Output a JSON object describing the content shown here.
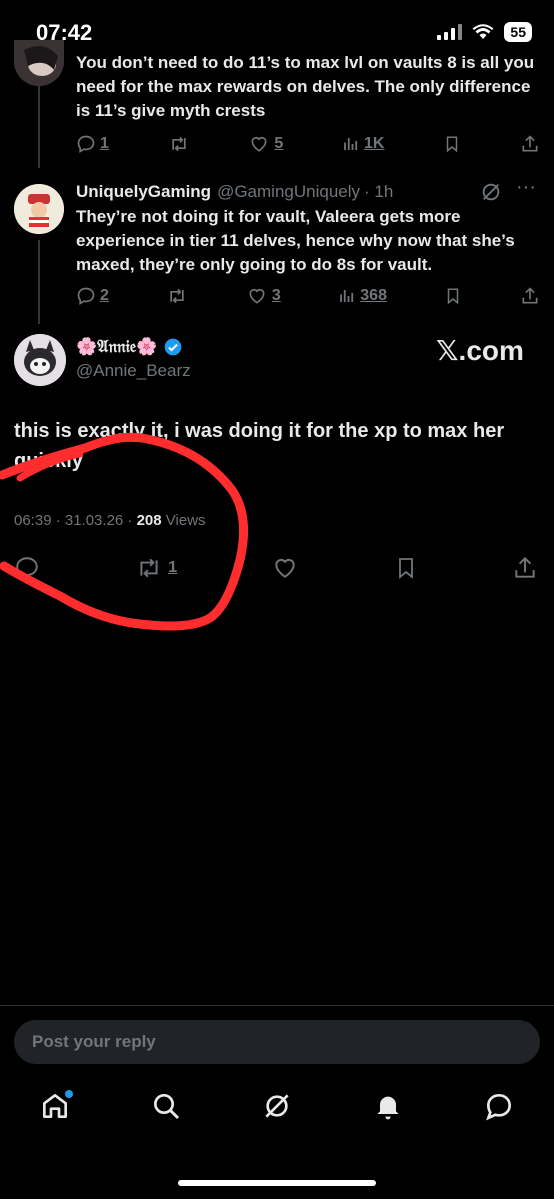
{
  "status_bar": {
    "time": "07:42",
    "battery": "55"
  },
  "thread": [
    {
      "text": "You don’t need to do 11’s to max lvl on vaults 8 is all you need for the max rewards on delves. The only difference is 11’s give myth crests",
      "replies": "1",
      "retweets": "",
      "likes": "5",
      "views": "1K"
    },
    {
      "name": "UniquelyGaming",
      "handle": "@GamingUniquely",
      "time": "· 1h",
      "text": "They’re not doing it for vault, Valeera gets more experience in tier 11 delves, hence why now that she’s maxed, they’re only going to do 8s for vault.",
      "replies": "2",
      "retweets": "",
      "likes": "3",
      "views": "368"
    }
  ],
  "main_tweet": {
    "name": "🌸𝔄𝔫𝔫𝔦𝔢🌸",
    "handle": "@Annie_Bearz",
    "watermark": "𝕏.com",
    "text": "this is exactly it, i was doing it for the xp to max her quickly",
    "timestamp": "06:39 · 31.03.26 · ",
    "views_count": "208",
    "views_label": "Views",
    "retweets": "1"
  },
  "reply_box": {
    "placeholder": "Post your reply"
  },
  "colors": {
    "background": "#000000",
    "muted": "#71767b",
    "text": "#e7e9ea",
    "annotation": "#ff2d2d",
    "verified": "#1d9bf0"
  },
  "nav_icons": [
    "home-icon",
    "search-icon",
    "grok-icon",
    "notifications-icon",
    "messages-icon"
  ]
}
